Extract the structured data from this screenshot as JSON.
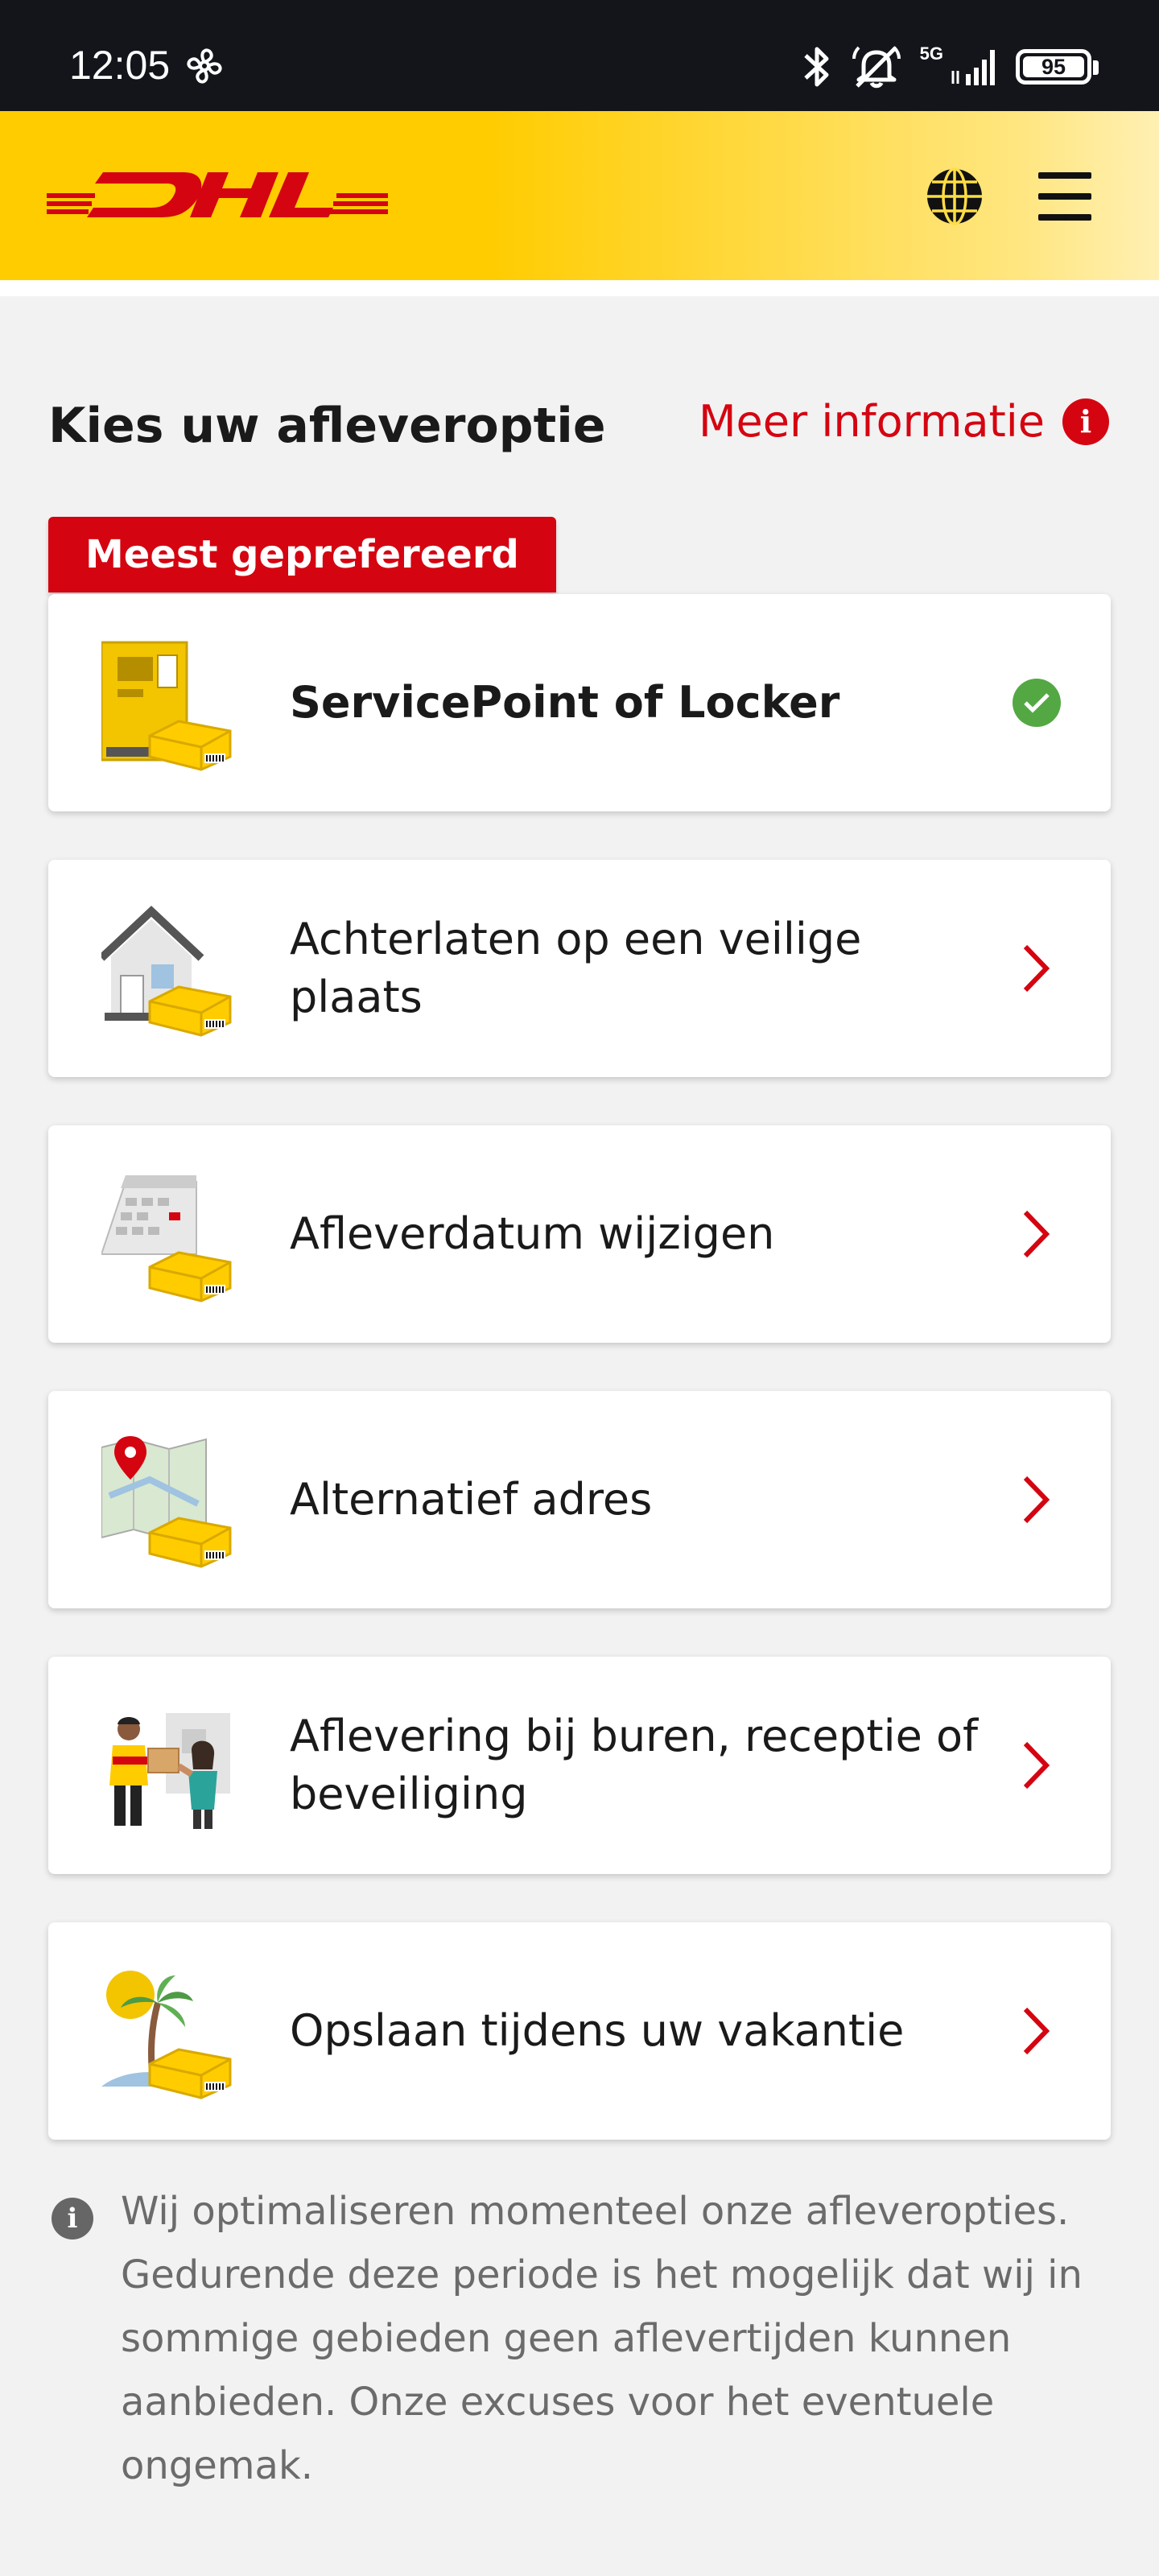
{
  "status_bar": {
    "time": "12:05",
    "network": "5G",
    "battery": "95"
  },
  "header": {
    "logo_text": "DHL",
    "language_icon": "globe-icon",
    "menu_icon": "hamburger-menu-icon"
  },
  "page": {
    "title": "Kies uw afleveroptie",
    "more_info": "Meer informatie",
    "preferred_badge": "Meest geprefereerd"
  },
  "options": [
    {
      "label": "ServicePoint of Locker",
      "icon": "locker-parcel-icon",
      "state": "selected"
    },
    {
      "label": "Achterlaten op een veilige plaats",
      "icon": "house-parcel-icon",
      "state": "chevron"
    },
    {
      "label": "Afleverdatum wijzigen",
      "icon": "calendar-parcel-icon",
      "state": "chevron"
    },
    {
      "label": "Alternatief adres",
      "icon": "map-parcel-icon",
      "state": "chevron"
    },
    {
      "label": "Aflevering bij buren, receptie of beveiliging",
      "icon": "neighbour-handover-icon",
      "state": "chevron"
    },
    {
      "label": "Opslaan tijdens uw vakantie",
      "icon": "vacation-parcel-icon",
      "state": "chevron"
    }
  ],
  "note": "Wij optimaliseren momenteel onze afleveropties. Gedurende deze periode is het mogelijk dat wij in sommige gebieden geen aflevertijden kunnen aanbieden. Onze excuses voor het eventuele ongemak.",
  "colors": {
    "dhl_yellow": "#ffcc00",
    "dhl_red": "#d40511",
    "success_green": "#54a844"
  }
}
